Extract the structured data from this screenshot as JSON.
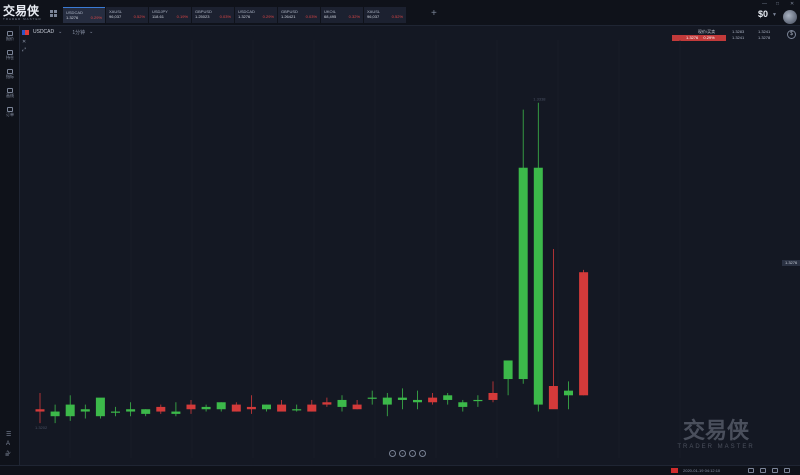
{
  "app": {
    "logo_cn": "交易侠",
    "logo_en": "TRADER MASTER"
  },
  "tickers": [
    {
      "symbol": "USDCAD",
      "price": "1.3276",
      "change": "0.29%",
      "active": true
    },
    {
      "symbol": "XAUSL",
      "price": "96,037",
      "change": "0.52%",
      "active": false
    },
    {
      "symbol": "USDJPY",
      "price": "118.61",
      "change": "0.19%",
      "active": false
    },
    {
      "symbol": "GBPUSD",
      "price": "1.25023",
      "change": "0.03%",
      "active": false
    },
    {
      "symbol": "USDCAD",
      "price": "1.3276",
      "change": "0.29%",
      "active": false
    },
    {
      "symbol": "GBPUSD",
      "price": "1.26421",
      "change": "0.03%",
      "active": false
    },
    {
      "symbol": "UKOIL",
      "price": "68,495",
      "change": "0.32%",
      "active": false
    },
    {
      "symbol": "XAUSL",
      "price": "96,037",
      "change": "0.52%",
      "active": false
    }
  ],
  "header": {
    "balance": "$0",
    "add_tab": "+"
  },
  "sidebar": [
    {
      "label": "报价"
    },
    {
      "label": "持仓"
    },
    {
      "label": "指标"
    },
    {
      "label": "画线"
    },
    {
      "label": "订单"
    }
  ],
  "chart_header": {
    "symbol": "USDCAD",
    "timeframe": "1分钟"
  },
  "order_box": {
    "label": "现价/买卖",
    "price": "1.3276",
    "change": "0.29%",
    "bid_label": "1.3283",
    "ask_label": "1.3241",
    "r1": "1.3241",
    "r2": "1.3278"
  },
  "price_tag": "1.3276",
  "status": {
    "time": "2020-01-19 04:12:10"
  },
  "colors": {
    "up": "#3cb94a",
    "down": "#d43a3a",
    "background": "#141823"
  },
  "chart_data": {
    "type": "candlestick",
    "low_label": "1.3202",
    "high_label": "1.3338",
    "ylim": [
      1.3185,
      1.3365
    ],
    "candles": [
      {
        "o": 1.3206,
        "h": 1.3213,
        "l": 1.32,
        "c": 1.3205
      },
      {
        "o": 1.3203,
        "h": 1.3208,
        "l": 1.32,
        "c": 1.3205
      },
      {
        "o": 1.3203,
        "h": 1.3212,
        "l": 1.3201,
        "c": 1.3208
      },
      {
        "o": 1.3205,
        "h": 1.3208,
        "l": 1.3202,
        "c": 1.3206
      },
      {
        "o": 1.3203,
        "h": 1.321,
        "l": 1.3202,
        "c": 1.3211
      },
      {
        "o": 1.3205,
        "h": 1.3207,
        "l": 1.3203,
        "c": 1.3205
      },
      {
        "o": 1.3205,
        "h": 1.3209,
        "l": 1.3203,
        "c": 1.3206
      },
      {
        "o": 1.3204,
        "h": 1.3206,
        "l": 1.3203,
        "c": 1.3206
      },
      {
        "o": 1.3207,
        "h": 1.3208,
        "l": 1.3204,
        "c": 1.3205
      },
      {
        "o": 1.3204,
        "h": 1.3209,
        "l": 1.3203,
        "c": 1.3205
      },
      {
        "o": 1.3208,
        "h": 1.321,
        "l": 1.3204,
        "c": 1.3206
      },
      {
        "o": 1.3206,
        "h": 1.3208,
        "l": 1.3205,
        "c": 1.3207
      },
      {
        "o": 1.3206,
        "h": 1.3209,
        "l": 1.3205,
        "c": 1.3209
      },
      {
        "o": 1.3208,
        "h": 1.3209,
        "l": 1.3205,
        "c": 1.3205
      },
      {
        "o": 1.3207,
        "h": 1.3212,
        "l": 1.3204,
        "c": 1.3206
      },
      {
        "o": 1.3206,
        "h": 1.3208,
        "l": 1.3205,
        "c": 1.3208
      },
      {
        "o": 1.3208,
        "h": 1.321,
        "l": 1.3206,
        "c": 1.3205
      },
      {
        "o": 1.3206,
        "h": 1.3208,
        "l": 1.3205,
        "c": 1.3206
      },
      {
        "o": 1.3208,
        "h": 1.321,
        "l": 1.3205,
        "c": 1.3205
      },
      {
        "o": 1.3209,
        "h": 1.3211,
        "l": 1.3207,
        "c": 1.3208
      },
      {
        "o": 1.3207,
        "h": 1.3212,
        "l": 1.3205,
        "c": 1.321
      },
      {
        "o": 1.3208,
        "h": 1.321,
        "l": 1.3206,
        "c": 1.3206
      },
      {
        "o": 1.3211,
        "h": 1.3214,
        "l": 1.3208,
        "c": 1.3211
      },
      {
        "o": 1.3208,
        "h": 1.3213,
        "l": 1.3203,
        "c": 1.3211
      },
      {
        "o": 1.321,
        "h": 1.3215,
        "l": 1.3206,
        "c": 1.3211
      },
      {
        "o": 1.3209,
        "h": 1.3214,
        "l": 1.3206,
        "c": 1.321
      },
      {
        "o": 1.3211,
        "h": 1.3213,
        "l": 1.3208,
        "c": 1.3209
      },
      {
        "o": 1.321,
        "h": 1.3213,
        "l": 1.3208,
        "c": 1.3212
      },
      {
        "o": 1.3207,
        "h": 1.321,
        "l": 1.3205,
        "c": 1.3209
      },
      {
        "o": 1.321,
        "h": 1.3212,
        "l": 1.3207,
        "c": 1.321
      },
      {
        "o": 1.3213,
        "h": 1.3218,
        "l": 1.3209,
        "c": 1.321
      },
      {
        "o": 1.3219,
        "h": 1.3226,
        "l": 1.3212,
        "c": 1.3227
      },
      {
        "o": 1.3219,
        "h": 1.3335,
        "l": 1.3217,
        "c": 1.331
      },
      {
        "o": 1.3208,
        "h": 1.3338,
        "l": 1.3205,
        "c": 1.331
      },
      {
        "o": 1.3216,
        "h": 1.3275,
        "l": 1.321,
        "c": 1.3206
      },
      {
        "o": 1.3212,
        "h": 1.3218,
        "l": 1.3206,
        "c": 1.3214
      },
      {
        "o": 1.3265,
        "h": 1.3266,
        "l": 1.3212,
        "c": 1.3212
      }
    ]
  }
}
